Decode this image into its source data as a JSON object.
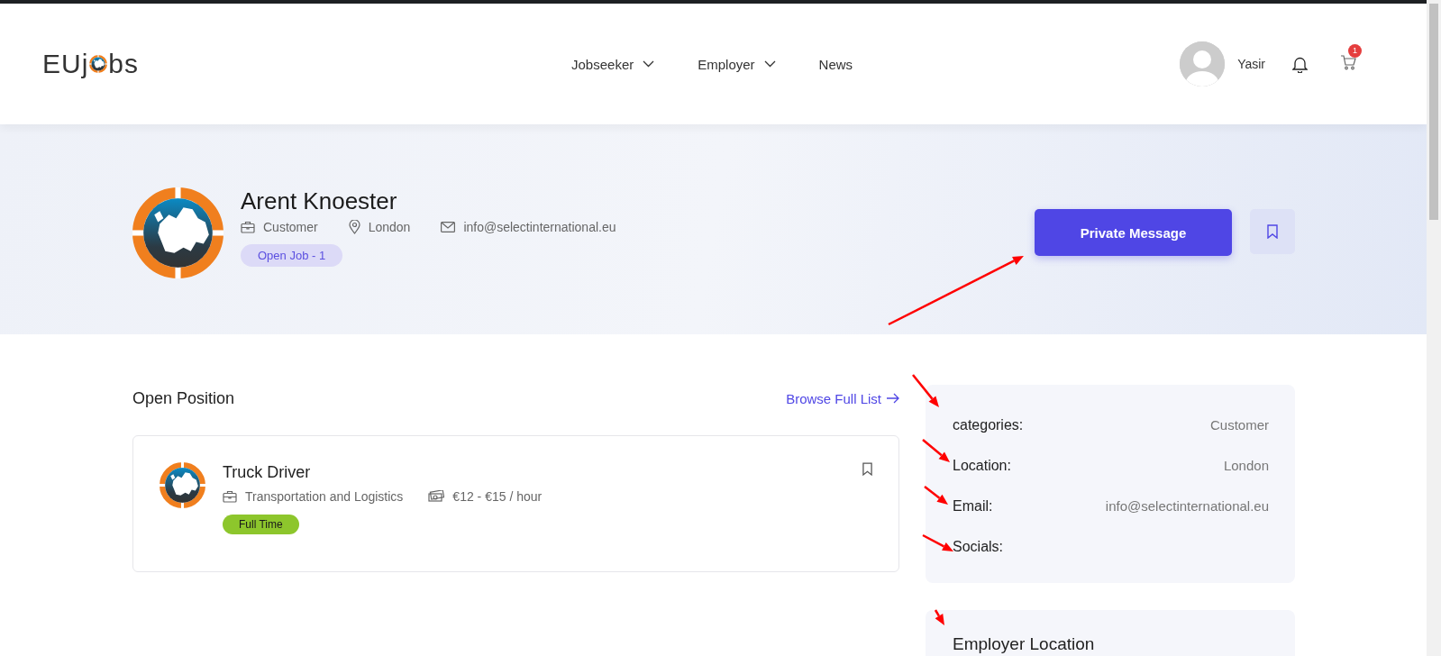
{
  "header": {
    "logo": {
      "left": "EUj",
      "right": "bs"
    },
    "nav": [
      {
        "label": "Jobseeker",
        "dropdown": true
      },
      {
        "label": "Employer",
        "dropdown": true
      },
      {
        "label": "News",
        "dropdown": false
      }
    ],
    "user": {
      "name": "Yasir"
    },
    "cart_count": "1"
  },
  "profile": {
    "name": "Arent Knoester",
    "category": "Customer",
    "location": "London",
    "email": "info@selectinternational.eu",
    "open_jobs": "Open Job - 1",
    "message_button": "Private Message"
  },
  "open_position": {
    "title": "Open Position",
    "browse_link": "Browse Full List",
    "jobs": [
      {
        "title": "Truck Driver",
        "category": "Transportation and Logistics",
        "salary": "€12 - €15 / hour",
        "type": "Full Time"
      }
    ]
  },
  "details": {
    "rows": [
      {
        "label": "categories:",
        "value": "Customer"
      },
      {
        "label": "Location:",
        "value": "London"
      },
      {
        "label": "Email:",
        "value": "info@selectinternational.eu"
      },
      {
        "label": "Socials:"
      }
    ]
  },
  "employer_location": {
    "title": "Employer Location"
  }
}
